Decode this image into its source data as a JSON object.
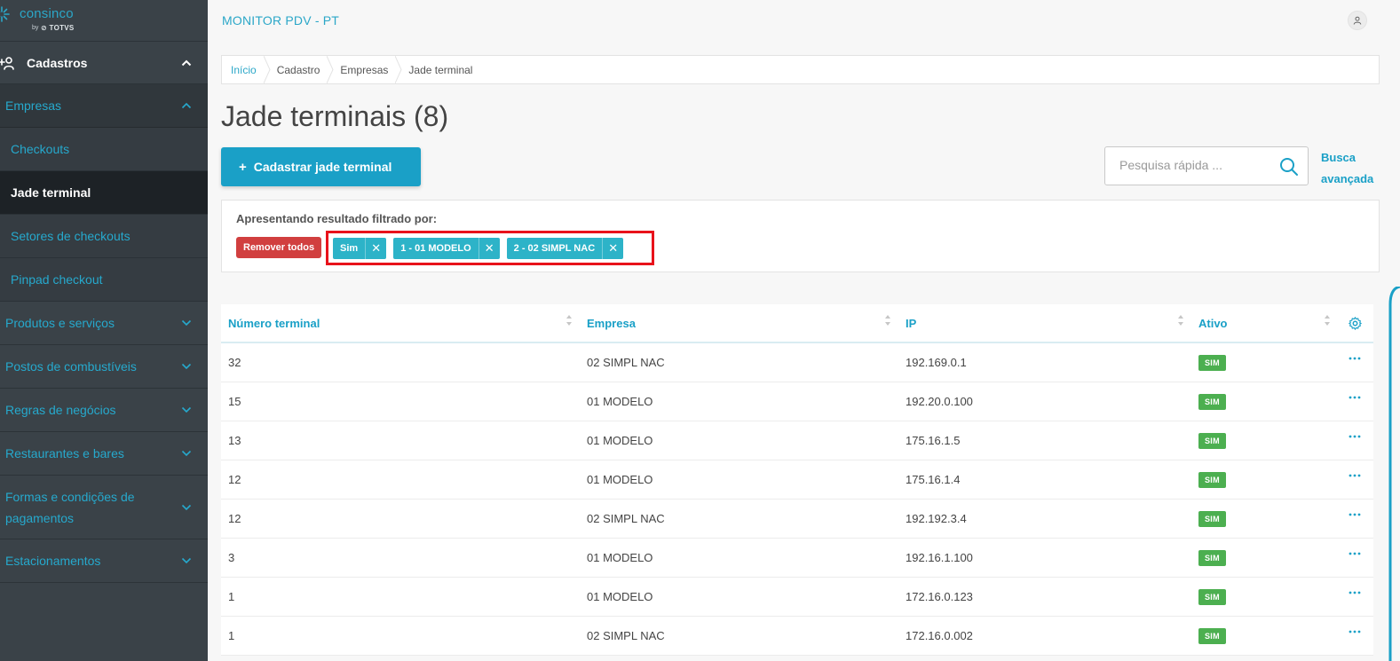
{
  "brand": {
    "name": "consinco",
    "by": "by",
    "parent": "TOTVS"
  },
  "app_title": "MONITOR PDV - PT",
  "sidebar": {
    "section": {
      "label": "Cadastros"
    },
    "subgroup": {
      "label": "Empresas"
    },
    "items": [
      {
        "label": "Checkouts",
        "active": false
      },
      {
        "label": "Jade terminal",
        "active": true
      },
      {
        "label": "Setores de checkouts",
        "active": false
      },
      {
        "label": "Pinpad checkout",
        "active": false
      }
    ],
    "groups": [
      {
        "label": "Produtos e serviços"
      },
      {
        "label": "Postos de combustíveis"
      },
      {
        "label": "Regras de negócios"
      },
      {
        "label": "Restaurantes e bares"
      },
      {
        "label": "Formas e condições de pagamentos"
      },
      {
        "label": "Estacionamentos"
      }
    ]
  },
  "breadcrumb": [
    "Início",
    "Cadastro",
    "Empresas",
    "Jade terminal"
  ],
  "page_title": "Jade terminais (8)",
  "actions": {
    "add_label": "Cadastrar jade terminal",
    "add_icon": "+"
  },
  "search": {
    "placeholder": "Pesquisa rápida ...",
    "advanced_label": "Busca avançada"
  },
  "filters": {
    "label": "Apresentando resultado filtrado por:",
    "remove_all": "Remover todos",
    "chips": [
      {
        "label": "Sim"
      },
      {
        "label": "1 - 01 MODELO"
      },
      {
        "label": "2 - 02 SIMPL NAC"
      }
    ],
    "highlight_color": "#e8121b"
  },
  "table": {
    "columns": [
      "Número terminal",
      "Empresa",
      "IP",
      "Ativo"
    ],
    "rows": [
      {
        "numero": "32",
        "empresa": "02 SIMPL NAC",
        "ip": "192.169.0.1",
        "ativo": "SIM"
      },
      {
        "numero": "15",
        "empresa": "01 MODELO",
        "ip": "192.20.0.100",
        "ativo": "SIM"
      },
      {
        "numero": "13",
        "empresa": "01 MODELO",
        "ip": "175.16.1.5",
        "ativo": "SIM"
      },
      {
        "numero": "12",
        "empresa": "01 MODELO",
        "ip": "175.16.1.4",
        "ativo": "SIM"
      },
      {
        "numero": "12",
        "empresa": "02 SIMPL NAC",
        "ip": "192.192.3.4",
        "ativo": "SIM"
      },
      {
        "numero": "3",
        "empresa": "01 MODELO",
        "ip": "192.16.1.100",
        "ativo": "SIM"
      },
      {
        "numero": "1",
        "empresa": "01 MODELO",
        "ip": "172.16.0.123",
        "ativo": "SIM"
      },
      {
        "numero": "1",
        "empresa": "02 SIMPL NAC",
        "ip": "172.16.0.002",
        "ativo": "SIM"
      }
    ]
  },
  "colors": {
    "primary": "#1aa0c7",
    "sidebar_bg": "#3a4248",
    "active_bg": "#1d2226",
    "chip": "#2db3c8",
    "danger": "#d13f3f",
    "success": "#4caf50"
  },
  "icons": {
    "user": "user-icon",
    "search": "search-icon",
    "settings": "gear-icon",
    "row_menu": "more-horizontal-icon",
    "sort": "sort-icon",
    "chevron_up": "chevron-up-icon",
    "chevron_down": "chevron-down-icon"
  }
}
